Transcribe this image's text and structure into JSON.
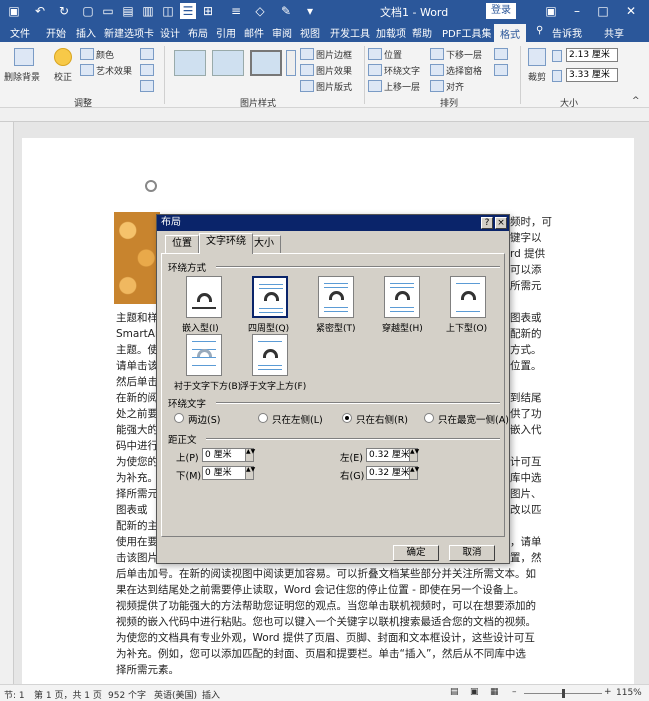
{
  "titlebar": {
    "doc_title": "文档1 - Word",
    "login": "登录"
  },
  "ribbon_tabs": [
    "文件",
    "开始",
    "插入",
    "新建选项卡",
    "设计",
    "布局",
    "引用",
    "邮件",
    "审阅",
    "视图",
    "开发工具",
    "加载项",
    "帮助",
    "PDF工具集",
    "格式"
  ],
  "tell_me": "告诉我",
  "share": "共享",
  "ribbon": {
    "remove_bg": "删除背景",
    "correct": "校正",
    "color": "颜色",
    "art_effects": "艺术效果",
    "adjust_group": "调整",
    "pic_border": "图片边框",
    "pic_effects": "图片效果",
    "pic_layout": "图片版式",
    "styles_group": "图片样式",
    "position": "位置",
    "wrap_text": "环绕文字",
    "bring_forward": "上移一层",
    "send_backward": "下移一层",
    "selection_pane": "选择窗格",
    "align": "对齐",
    "arrange_group": "排列",
    "crop": "裁剪",
    "height": "2.13 厘米",
    "width": "3.33 厘米",
    "size_group": "大小"
  },
  "document": {
    "lines": [
      "主题和样",
      "SmartArt",
      "主题。使",
      "请单击该",
      "然后单击",
      "在新的阅",
      "处之前要",
      "能强大的",
      "码中进行",
      "为使您的",
      "为补充。",
      "择所需元",
      "图表或",
      "配新的主",
      "使用在要",
      "击该图片",
      "后单击加号。在新的阅读视图中阅读更加容易。可以折叠文档某些部分并关注所需文本。如",
      "果在达到结尾处之前需要停止读取，Word 会记住您的停止位置 - 即使在另一个设备上。",
      "视频提供了功能强大的方法帮助您证明您的观点。当您单击联机视频时，可以在想要添加的",
      "视频的嵌入代码中进行粘贴。您也可以键入一个关键字以联机搜索最适合您的文档的视频。",
      "为使您的文档具有专业外观，Word 提供了页眉、页脚、封面和文本框设计，这些设计可互",
      "为补充。例如，您可以添加匹配的封面、页眉和提要栏。单击“插入”，然后从不同库中选",
      "择所需元素。"
    ],
    "right_lines": [
      "频时，可",
      "键字以",
      "rd 提供",
      "可以添",
      "所需元",
      "图表或",
      "配新的",
      "方式。",
      "位置。",
      "到结尾",
      "供了功",
      "嵌入代",
      "计可互",
      "库中选",
      "图片、",
      "改以匹",
      "，请单",
      "置，然"
    ]
  },
  "dialog": {
    "title": "布局",
    "help": "?",
    "close": "×",
    "tabs": [
      "位置",
      "文字环绕",
      "大小"
    ],
    "wrap_style_heading": "环绕方式",
    "wrap_options": [
      "嵌入型(I)",
      "四周型(Q)",
      "紧密型(T)",
      "穿越型(H)",
      "上下型(O)",
      "衬于文字下方(B)",
      "浮于文字上方(F)"
    ],
    "wrap_text_heading": "环绕文字",
    "wrap_text_options": [
      "两边(S)",
      "只在左侧(L)",
      "只在右侧(R)",
      "只在最宽一侧(A)"
    ],
    "distance_heading": "距正文",
    "top_label": "上(P)",
    "top_value": "0 厘米",
    "bottom_label": "下(M)",
    "bottom_value": "0 厘米",
    "left_label": "左(E)",
    "left_value": "0.32 厘米",
    "right_label": "右(G)",
    "right_value": "0.32 厘米",
    "ok": "确定",
    "cancel": "取消"
  },
  "status": {
    "page": "节: 1",
    "pages": "第 1 页，共 1 页",
    "words": "952 个字",
    "lang": "英语(美国)",
    "mode": "插入",
    "zoom": "115%"
  }
}
